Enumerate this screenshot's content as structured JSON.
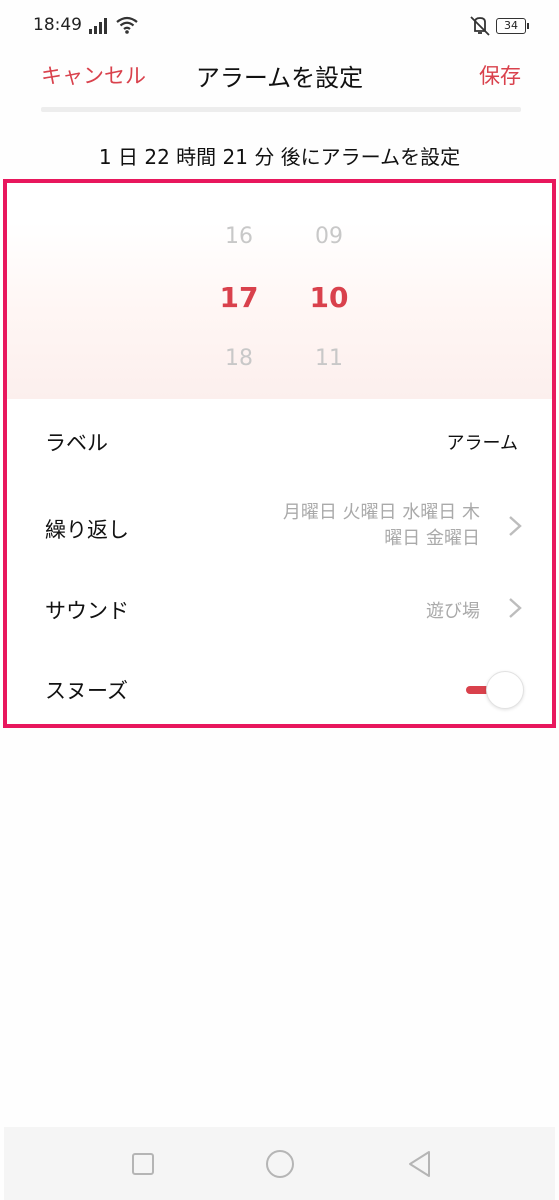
{
  "status_bar": {
    "time": "18:49",
    "battery": "34",
    "icons": [
      "signal-icon",
      "wifi-icon",
      "mute-icon",
      "battery-icon"
    ]
  },
  "header": {
    "cancel_label": "キャンセル",
    "title": "アラームを設定",
    "save_label": "保存"
  },
  "countdown": "1 日 22 時間 21 分 後にアラームを設定",
  "picker": {
    "hours": {
      "prev": "16",
      "current": "17",
      "next": "18"
    },
    "minutes": {
      "prev": "09",
      "current": "10",
      "next": "11"
    }
  },
  "settings": {
    "label": {
      "title": "ラベル",
      "value": "アラーム"
    },
    "repeat": {
      "title": "繰り返し",
      "value_line1": "月曜日 火曜日 水曜日 木",
      "value_line2": "曜日 金曜日"
    },
    "sound": {
      "title": "サウンド",
      "value": "遊び場"
    },
    "snooze": {
      "title": "スヌーズ",
      "enabled": true
    }
  },
  "colors": {
    "accent": "#d9414c",
    "highlight_border": "#e8175d",
    "secondary_text": "#aaaaaa",
    "picker_inactive": "#c8c8c8"
  },
  "nav_bar": {
    "icons": [
      "recents-square-icon",
      "home-circle-icon",
      "back-triangle-icon"
    ]
  }
}
